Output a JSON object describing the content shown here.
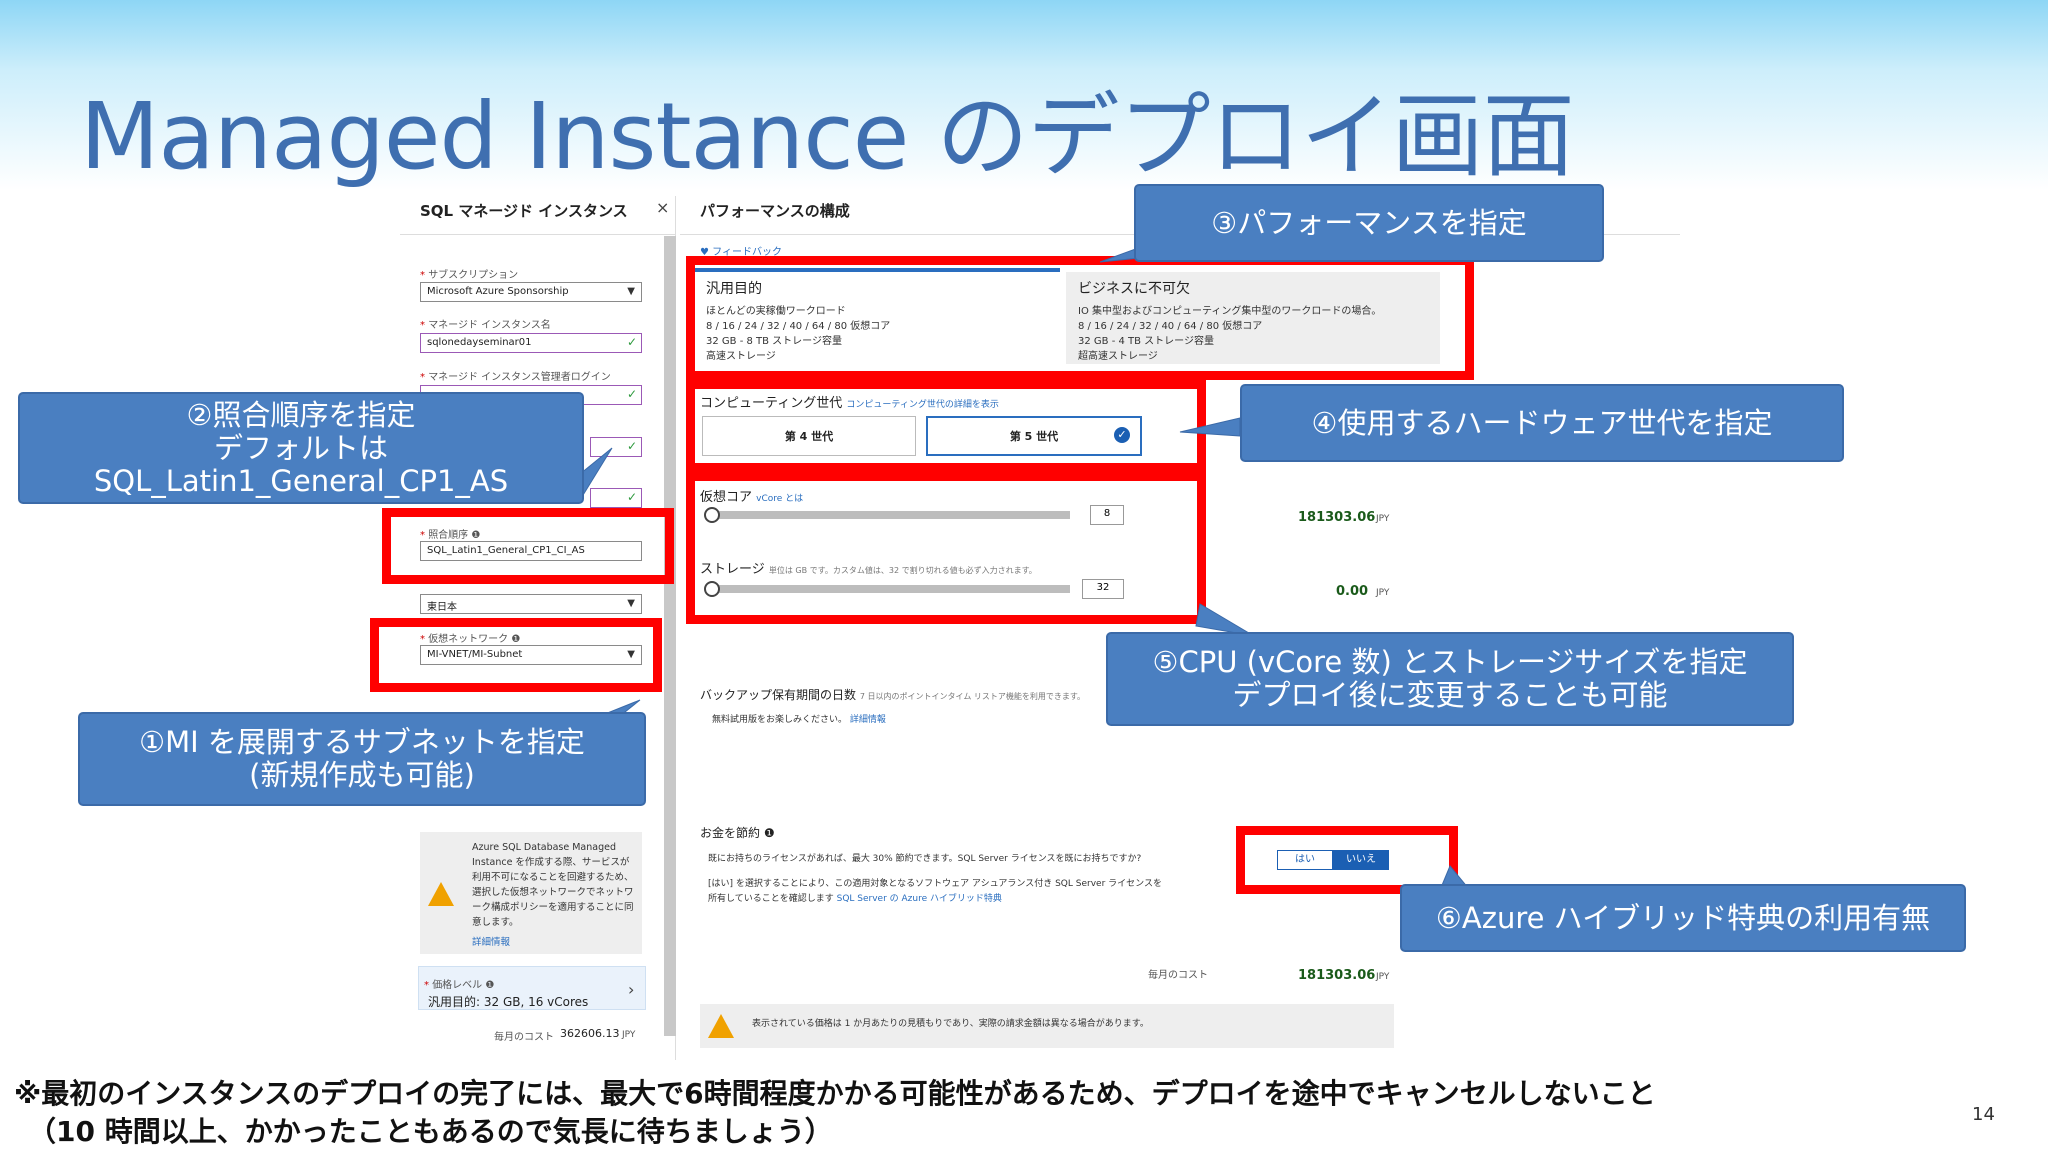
{
  "slide": {
    "title": "Managed Instance のデプロイ画面",
    "page_number": "14",
    "footnote_line1": "※最初のインスタンスのデプロイの完了には、最大で6時間程度かかる可能性があるため、デプロイを途中でキャンセルしないこと",
    "footnote_line2": "（10 時間以上、かかったこともあるので気長に待ちましょう）"
  },
  "left_blade": {
    "title": "SQL マネージド インスタンス",
    "close_glyph": "×",
    "subscription_label": "サブスクリプション",
    "subscription_value": "Microsoft Azure Sponsorship",
    "instance_name_label": "マネージド インスタンス名",
    "instance_name_value": "sqlonedayseminar01",
    "admin_login_label": "マネージド インスタンス管理者ログイン",
    "collation_label": "照合順序",
    "collation_value": "SQL_Latin1_General_CP1_CI_AS",
    "location_value": "東日本",
    "vnet_label": "仮想ネットワーク",
    "vnet_value": "MI-VNET/MI-Subnet",
    "info_text": "Azure SQL Database Managed Instance を作成する際、サービスが利用不可になることを回避するため、選択した仮想ネットワークでネットワーク構成ポリシーを適用することに同意します。",
    "info_link": "詳細情報",
    "pricing_tier_label": "価格レベル",
    "pricing_tier_value": "汎用目的: 32 GB, 16 vCores",
    "monthly_cost_label": "毎月のコスト",
    "monthly_cost_value": "362606.13",
    "monthly_cost_unit": "JPY"
  },
  "right_blade": {
    "title": "パフォーマンスの構成",
    "feedback": "フィードバック",
    "tier_general": {
      "name": "汎用目的",
      "line1": "ほとんどの実稼働ワークロード",
      "line2": "8 / 16 / 24 / 32 / 40 / 64 / 80 仮想コア",
      "line3": "32 GB - 8 TB ストレージ容量",
      "line4": "高速ストレージ"
    },
    "tier_business": {
      "name": "ビジネスに不可欠",
      "line1": "IO 集中型およびコンピューティング集中型のワークロードの場合。",
      "line2": "8 / 16 / 24 / 32 / 40 / 64 / 80 仮想コア",
      "line3": "32 GB - 4 TB ストレージ容量",
      "line4": "超高速ストレージ"
    },
    "compute_gen_label": "コンピューティング世代",
    "compute_gen_link": "コンピューティング世代の詳細を表示",
    "gen4": "第 4 世代",
    "gen5": "第 5 世代",
    "vcore_label": "仮想コア",
    "vcore_link": "vCore とは",
    "vcore_value": "8",
    "vcore_cost": "181303.06",
    "storage_label": "ストレージ",
    "storage_hint": "単位は GB です。カスタム値は、32 で割り切れる値も必ず入力されます。",
    "storage_value": "32",
    "storage_cost": "0.00",
    "currency": "JPY",
    "backup_label": "バックアップ保有期間の日数",
    "backup_hint": "7 日以内のポイントインタイム リストア機能を利用できます。",
    "backup_line2": "無料試用版をお楽しみください。",
    "backup_link": "詳細情報",
    "save_label": "お金を節約",
    "save_line1": "既にお持ちのライセンスがあれば、最大 30% 節約できます。SQL Server ライセンスを既にお持ちですか?",
    "save_line2": "[はい] を選択することにより、この適用対象となるソフトウェア アシュアランス付き SQL Server ライセンスを",
    "save_line3": "所有していることを確認します",
    "save_link": "SQL Server の Azure ハイブリッド特典",
    "yes": "はい",
    "no": "いいえ",
    "monthly_cost_label": "毎月のコスト",
    "monthly_cost_value": "181303.06",
    "estimate_note": "表示されている価格は 1 か月あたりの見積もりであり、実際の請求金額は異なる場合があります。"
  },
  "callouts": {
    "c1_line1": "①MI を展開するサブネットを指定",
    "c1_line2": "(新規作成も可能)",
    "c2_line1": "②照合順序を指定",
    "c2_line2": "デフォルトは",
    "c2_line3": "SQL_Latin1_General_CP1_AS",
    "c3": "③パフォーマンスを指定",
    "c4": "④使用するハードウェア世代を指定",
    "c5_line1": "⑤CPU (vCore 数) とストレージサイズを指定",
    "c5_line2": "デプロイ後に変更することも可能",
    "c6": "⑥Azure ハイブリッド特典の利用有無"
  },
  "colors": {
    "callout_blue": "#4a7fc1",
    "highlight_red": "#ff0000",
    "title_blue": "#3f6fb0",
    "price_green": "#1a5a1a",
    "warning_orange": "#f0a100"
  }
}
